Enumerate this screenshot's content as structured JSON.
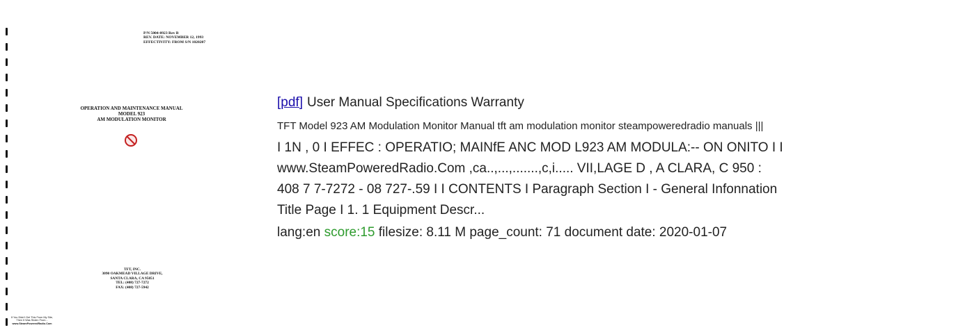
{
  "thumbnail": {
    "header_lines": [
      "P/N 5004-0923 Rev B",
      "REV. DATE: NOVEMBER 12, 1993",
      "EFFECTIVITY: FROM S/N 1020207"
    ],
    "title_lines": [
      "OPERATION AND MAINTENANCE MANUAL",
      "MODEL 923",
      "AM MODULATION MONITOR"
    ],
    "address_lines": [
      "TFT, INC.",
      "3090 OAKMEAD VILLAGE DRIVE,",
      "SANTA CLARA, CA 95051",
      "TEL: (408) 727-7272",
      "FAX: (408) 727-5942"
    ],
    "watermark_lines": [
      "If You Didn't Get This From My Site,",
      "Then It Was Stolen From...",
      "www.SteamPoweredRadio.Com"
    ]
  },
  "result": {
    "pdf_link": "[pdf]",
    "title": "User Manual Specifications Warranty",
    "tags": "TFT Model 923 AM Modulation Monitor Manual tft am modulation monitor steampoweredradio manuals |||",
    "snippet_lines": [
      "I 1N , 0 I EFFEC : OPERATIO; MAINfE ANC MOD L923 AM MODULA:-- ON ONITO I I",
      "www.SteamPoweredRadio.Com ,ca..,...,.......,c,i..... VII,LAGE D , A CLARA, C 950 :",
      "408 7 7-7272 - 08 727-.59 I I CONTENTS I Paragraph Section I - General Infonnation",
      "Title Page I 1. 1 Equipment Descr..."
    ],
    "meta": {
      "lang": "lang:en",
      "score": "score:15",
      "rest": "filesize: 8.11 M page_count: 71 document date: 2020-01-07"
    }
  },
  "colors": {
    "link": "#1a0dab",
    "score": "#2e9b2e",
    "text": "#222222"
  }
}
